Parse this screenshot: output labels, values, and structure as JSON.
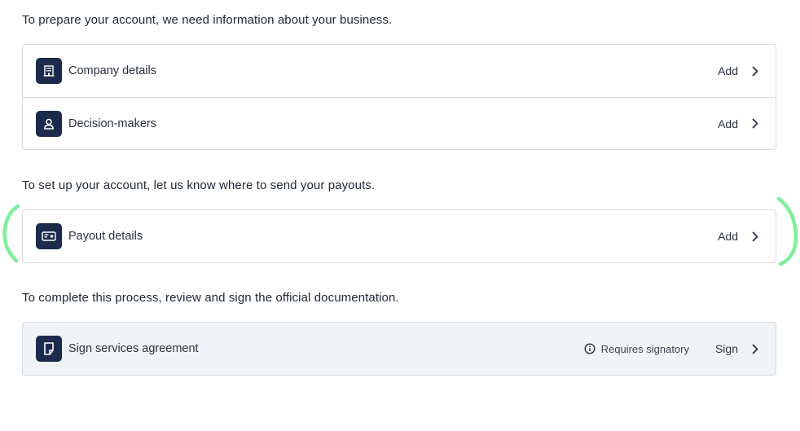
{
  "sections": [
    {
      "heading": "To prepare your account, we need information about your business.",
      "items": [
        {
          "label": "Company details",
          "icon": "building-icon",
          "action": "Add"
        },
        {
          "label": "Decision-makers",
          "icon": "person-icon",
          "action": "Add"
        }
      ]
    },
    {
      "heading": "To set up your account, let us know where to send your payouts.",
      "items": [
        {
          "label": "Payout details",
          "icon": "bank-card-icon",
          "action": "Add"
        }
      ]
    },
    {
      "heading": "To complete this process, review and sign the official documentation.",
      "items": [
        {
          "label": "Sign services agreement",
          "icon": "document-icon",
          "note": "Requires signatory",
          "note_icon": "info-icon",
          "action": "Sign"
        }
      ]
    }
  ],
  "colors": {
    "icon_background": "#1c2b4d",
    "border": "#d7dbe1",
    "highlight_annotation": "#7ef09a",
    "signature_card_background": "#f1f4f7"
  }
}
